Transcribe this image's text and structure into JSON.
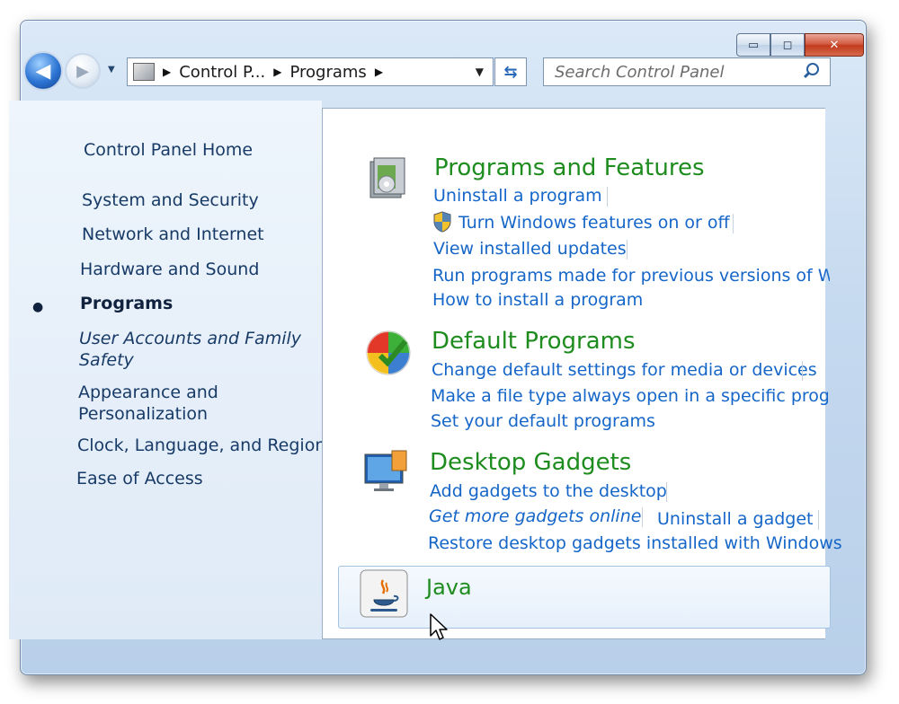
{
  "window": {
    "caption_buttons": {
      "minimize": "▭",
      "maximize": "◻",
      "close": "✕"
    }
  },
  "nav": {
    "back_glyph": "◀",
    "forward_glyph": "▶",
    "history_glyph": "▼",
    "breadcrumbs": [
      "Control P...",
      "Programs"
    ],
    "crumb_separator": "▶",
    "dropdown_glyph": "▼",
    "refresh_glyph": "⇆",
    "search_placeholder": "Search Control Panel"
  },
  "sidebar": {
    "home": "Control Panel Home",
    "items": [
      {
        "label": "System and Security"
      },
      {
        "label": "Network and Internet"
      },
      {
        "label": "Hardware and Sound"
      },
      {
        "label": "Programs",
        "active": true
      },
      {
        "label": "User Accounts and Family Safety"
      },
      {
        "label": "Appearance and Personalization"
      },
      {
        "label": "Clock, Language, and Region"
      },
      {
        "label": "Ease of Access"
      }
    ],
    "active_bullet": "●"
  },
  "categories": [
    {
      "title": "Programs and Features",
      "icon": "programs-features-icon",
      "tasks": [
        "Uninstall a program",
        "Turn Windows features on or off",
        "View installed updates",
        "Run programs made for previous versions of Wind",
        "How to install a program"
      ]
    },
    {
      "title": "Default Programs",
      "icon": "default-programs-icon",
      "tasks": [
        "Change default settings for media or devices",
        "Make a file type always open in a specific program",
        "Set your default programs"
      ]
    },
    {
      "title": "Desktop Gadgets",
      "icon": "desktop-gadgets-icon",
      "tasks": [
        "Add gadgets to the desktop",
        "Get more gadgets online",
        "Uninstall a gadget",
        "Restore desktop gadgets installed with Windows"
      ]
    },
    {
      "title": "Java",
      "icon": "java-icon",
      "tasks": []
    }
  ],
  "colors": {
    "category_title": "#1e8c1e",
    "task_link": "#1566c8",
    "sidebar_text": "#173a66"
  }
}
